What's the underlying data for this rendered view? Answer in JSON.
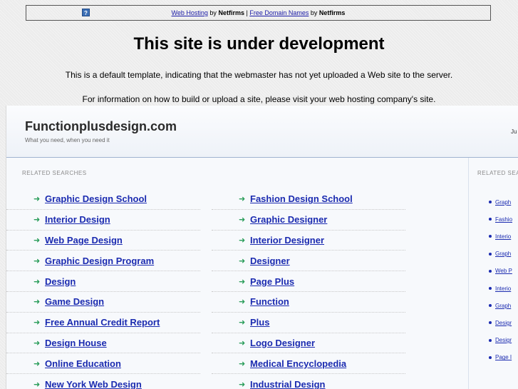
{
  "banner": {
    "icon": "help-icon",
    "link1": "Web Hosting",
    "by1": "by",
    "brand1": "Netfirms",
    "sep": "|",
    "link2": "Free Domain Names",
    "by2": "by",
    "brand2": "Netfirms"
  },
  "notice": {
    "title": "This site is under development",
    "line1": "This is a default template, indicating that the webmaster has not yet uploaded a Web site to the server.",
    "line2": "For information on how to build or upload a site, please visit your web hosting company's site."
  },
  "site": {
    "name": "Functionplusdesign.com",
    "tagline": "What you need, when you need it",
    "date_fragment": "Ju"
  },
  "main": {
    "section_label": "RELATED SEARCHES",
    "left_column": [
      "Graphic Design School",
      "Interior Design",
      "Web Page Design",
      "Graphic Design Program",
      "Design",
      "Game Design",
      "Free Annual Credit Report",
      "Design House",
      "Online Education",
      "New York Web Design"
    ],
    "right_column": [
      "Fashion Design School",
      "Graphic Designer",
      "Interior Designer",
      "Designer",
      "Page Plus",
      "Function",
      "Plus",
      "Logo Designer",
      "Medical Encyclopedia",
      "Industrial Design"
    ]
  },
  "sidebar": {
    "section_label": "RELATED SEA",
    "items": [
      "Graph",
      "Fashio",
      "Interio",
      "Graph",
      "Web P",
      "Interio",
      "Graph",
      "Desigr",
      "Desigr",
      "Page I"
    ]
  },
  "colors": {
    "link": "#1b2bb0",
    "arrow": "#2a9d5a",
    "header_border": "#9fb3cf"
  }
}
